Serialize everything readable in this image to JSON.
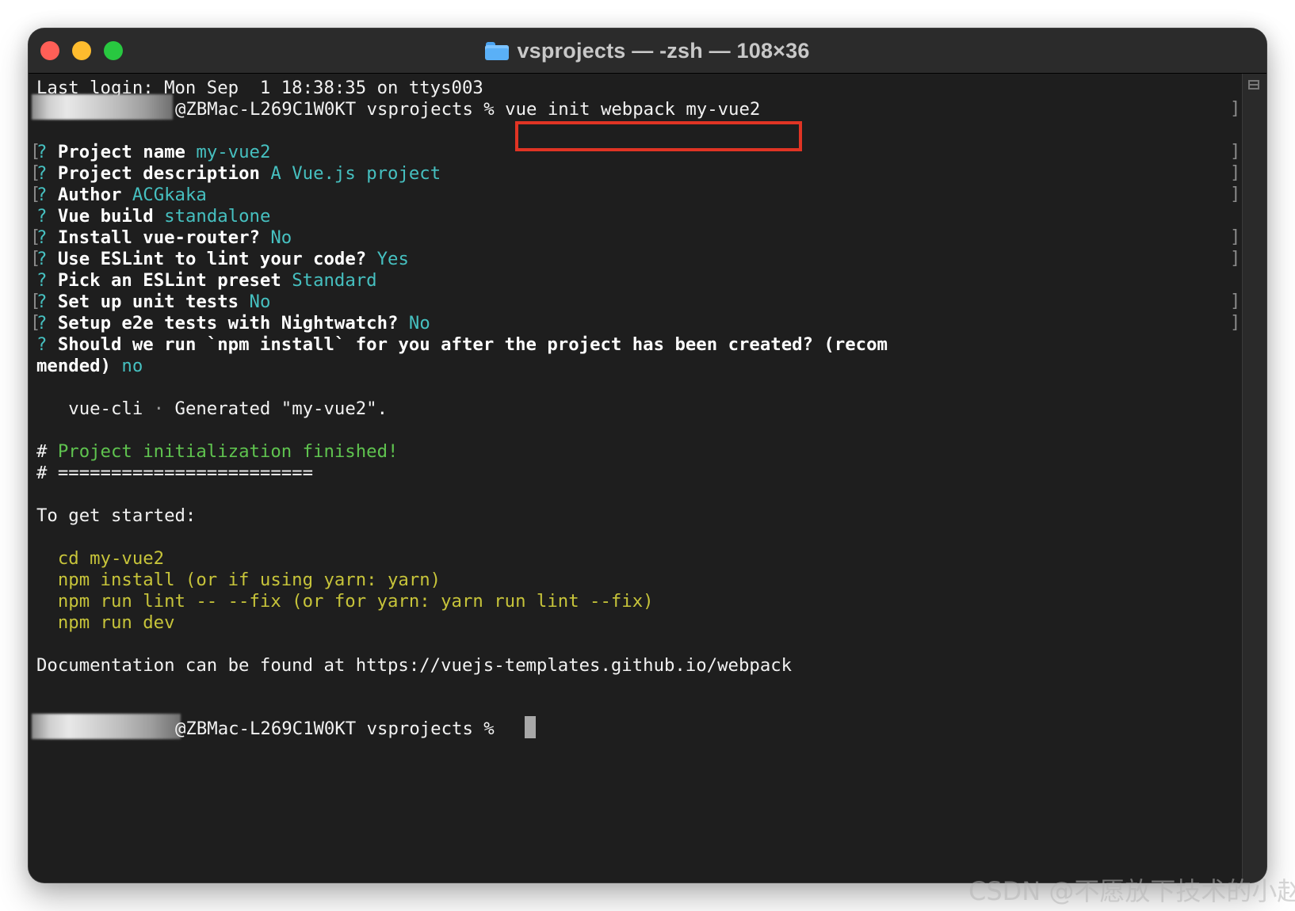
{
  "window": {
    "title": "vsprojects — -zsh — 108×36",
    "folder_icon": "folder-icon",
    "controls": [
      "close",
      "minimize",
      "zoom"
    ]
  },
  "terminal": {
    "last_login": "Last login: Mon Sep  1 18:38:35 on ttys003",
    "prompt_host": "@ZBMac-L269C1W0KT vsprojects % ",
    "command": "vue init webpack my-vue2",
    "questions": [
      {
        "mark": "?",
        "label": "Project name",
        "answer": "my-vue2"
      },
      {
        "mark": "?",
        "label": "Project description",
        "answer": "A Vue.js project"
      },
      {
        "mark": "?",
        "label": "Author",
        "answer": "ACGkaka"
      },
      {
        "mark": "?",
        "label": "Vue build",
        "answer": "standalone"
      },
      {
        "mark": "?",
        "label": "Install vue-router?",
        "answer": "No"
      },
      {
        "mark": "?",
        "label": "Use ESLint to lint your code?",
        "answer": "Yes"
      },
      {
        "mark": "?",
        "label": "Pick an ESLint preset",
        "answer": "Standard"
      },
      {
        "mark": "?",
        "label": "Set up unit tests",
        "answer": "No"
      },
      {
        "mark": "?",
        "label": "Setup e2e tests with Nightwatch?",
        "answer": "No"
      },
      {
        "mark": "?",
        "label": "Should we run `npm install` for you after the project has been created? (recom",
        "label_cont": "mended)",
        "answer": "no"
      }
    ],
    "generated_prefix": "   vue-cli ",
    "generated_dot": "·",
    "generated_text": " Generated \"my-vue2\".",
    "finished_hash": "# ",
    "finished_text": "Project initialization finished!",
    "rule_line": "# ========================",
    "get_started": "To get started:",
    "steps": [
      "  cd my-vue2",
      "  npm install (or if using yarn: yarn)",
      "  npm run lint -- --fix (or for yarn: yarn run lint --fix)",
      "  npm run dev"
    ],
    "documentation": "Documentation can be found at https://vuejs-templates.github.io/webpack",
    "final_prompt_host": "@ZBMac-L269C1W0KT vsprojects % "
  },
  "colors": {
    "background": "#1e1e1e",
    "answer": "#46c0c0",
    "success": "#5fc34f",
    "steps": "#c7c43a",
    "highlight_border": "#e03424"
  },
  "watermark": "CSDN @不愿放下技术的小赵"
}
